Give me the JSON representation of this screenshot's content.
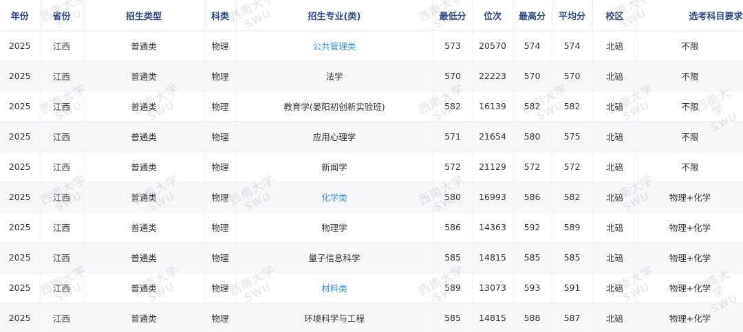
{
  "table": {
    "headers": [
      "年份",
      "省份",
      "招生类型",
      "科类",
      "招生专业(类)",
      "最低分",
      "位次",
      "最高分",
      "平均分",
      "校区",
      "选考科目要求"
    ],
    "rows": [
      {
        "year": "2025",
        "province": "江西",
        "type": "普通类",
        "subject": "物理",
        "major": "公共管理类",
        "min": "573",
        "rank": "20570",
        "max": "574",
        "avg": "574",
        "campus": "北碚",
        "req": "不限"
      },
      {
        "year": "2025",
        "province": "江西",
        "type": "普通类",
        "subject": "物理",
        "major": "法学",
        "min": "570",
        "rank": "22223",
        "max": "570",
        "avg": "570",
        "campus": "北碚",
        "req": "不限"
      },
      {
        "year": "2025",
        "province": "江西",
        "type": "普通类",
        "subject": "物理",
        "major": "教育学(晏阳初创新实验班)",
        "min": "582",
        "rank": "16139",
        "max": "582",
        "avg": "582",
        "campus": "北碚",
        "req": "不限"
      },
      {
        "year": "2025",
        "province": "江西",
        "type": "普通类",
        "subject": "物理",
        "major": "应用心理学",
        "min": "571",
        "rank": "21654",
        "max": "580",
        "avg": "575",
        "campus": "北碚",
        "req": "不限"
      },
      {
        "year": "2025",
        "province": "江西",
        "type": "普通类",
        "subject": "物理",
        "major": "新闻学",
        "min": "572",
        "rank": "21129",
        "max": "572",
        "avg": "572",
        "campus": "北碚",
        "req": "不限"
      },
      {
        "year": "2025",
        "province": "江西",
        "type": "普通类",
        "subject": "物理",
        "major": "化学类",
        "min": "580",
        "rank": "16993",
        "max": "586",
        "avg": "582",
        "campus": "北碚",
        "req": "物理+化学"
      },
      {
        "year": "2025",
        "province": "江西",
        "type": "普通类",
        "subject": "物理",
        "major": "物理学",
        "min": "586",
        "rank": "14363",
        "max": "592",
        "avg": "589",
        "campus": "北碚",
        "req": "物理+化学"
      },
      {
        "year": "2025",
        "province": "江西",
        "type": "普通类",
        "subject": "物理",
        "major": "量子信息科学",
        "min": "585",
        "rank": "14815",
        "max": "585",
        "avg": "585",
        "campus": "北碚",
        "req": "物理+化学"
      },
      {
        "year": "2025",
        "province": "江西",
        "type": "普通类",
        "subject": "物理",
        "major": "材料类",
        "min": "589",
        "rank": "13073",
        "max": "593",
        "avg": "591",
        "campus": "北碚",
        "req": "物理+化学"
      },
      {
        "year": "2025",
        "province": "江西",
        "type": "普通类",
        "subject": "物理",
        "major": "环境科学与工程",
        "min": "585",
        "rank": "14815",
        "max": "588",
        "avg": "587",
        "campus": "北碚",
        "req": "物理+化学"
      }
    ]
  },
  "watermark": {
    "cn": "西南大学",
    "en": "SWU"
  },
  "colors": {
    "header_text": "#2f4a8a",
    "link": "#3a8ee6",
    "stripe": "#f7f8fa"
  }
}
